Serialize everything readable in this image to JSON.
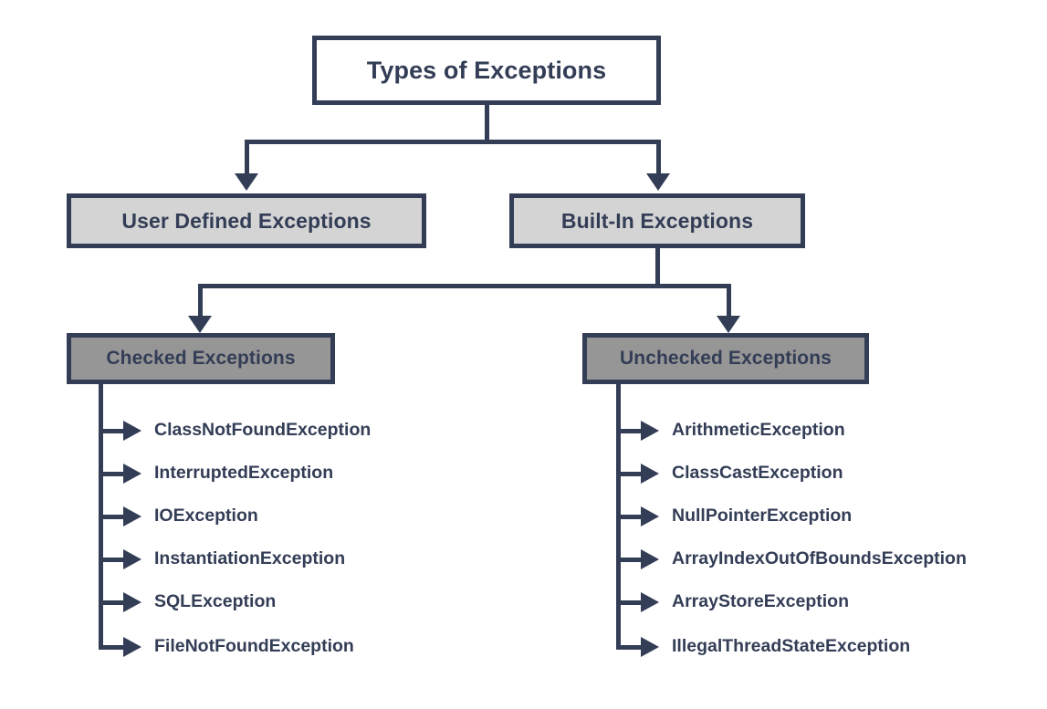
{
  "diagram": {
    "title": "Types of Exceptions",
    "colors": {
      "stroke": "#333d56",
      "text": "#333d56",
      "root_fill": "#ffffff",
      "level2_fill": "#d4d4d4",
      "level3_fill": "#969696",
      "background": "#ffffff"
    },
    "root": {
      "label": "Types of Exceptions"
    },
    "level2": [
      {
        "label": "User Defined Exceptions"
      },
      {
        "label": "Built-In Exceptions"
      }
    ],
    "level3": [
      {
        "label": "Checked Exceptions"
      },
      {
        "label": "Unchecked Exceptions"
      }
    ],
    "checked_exceptions": [
      {
        "label": "ClassNotFoundException"
      },
      {
        "label": "InterruptedException"
      },
      {
        "label": "IOException"
      },
      {
        "label": "InstantiationException"
      },
      {
        "label": "SQLException"
      },
      {
        "label": "FileNotFoundException"
      }
    ],
    "unchecked_exceptions": [
      {
        "label": "ArithmeticException"
      },
      {
        "label": "ClassCastException"
      },
      {
        "label": "NullPointerException"
      },
      {
        "label": "ArrayIndexOutOfBoundsException"
      },
      {
        "label": "ArrayStoreException"
      },
      {
        "label": "IllegalThreadStateException"
      }
    ]
  }
}
